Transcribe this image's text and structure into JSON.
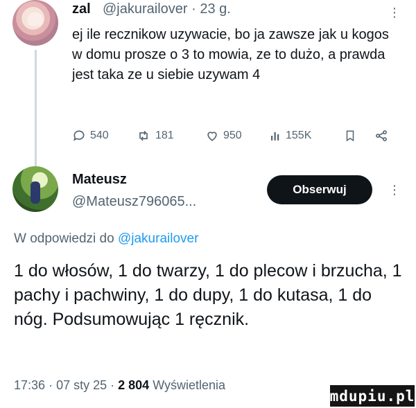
{
  "tweet1": {
    "author_name": "zal",
    "author_handle": "@jakurailover",
    "time": "23 g.",
    "text": "ej ile recznikow uzywacie, bo ja zawsze jak u kogos w domu prosze o 3 to mowia, ze to dużo, a prawda jest taka ze u siebie uzywam 4",
    "replies": "540",
    "reposts": "181",
    "likes": "950",
    "views": "155K"
  },
  "tweet2": {
    "author_name": "Mateusz",
    "author_handle": "@Mateusz796065...",
    "follow_label": "Obserwuj",
    "replying_prefix": "W odpowiedzi do",
    "replying_to": "@jakurailover",
    "text": "1 do włosów, 1 do twarzy, 1 do plecow i brzucha, 1 pachy i pachwiny, 1 do dupy, 1 do kutasa, 1 do nóg. Podsumowując 1 ręcznik.",
    "time": "17:36",
    "date": "07 sty 25",
    "views_count": "2 804",
    "views_label": "Wyświetlenia"
  },
  "watermark": "mdupiu.pl",
  "colors": {
    "text": "#0f1419",
    "secondary": "#536471",
    "link": "#1d9bf0",
    "divider": "#cfd9de"
  }
}
